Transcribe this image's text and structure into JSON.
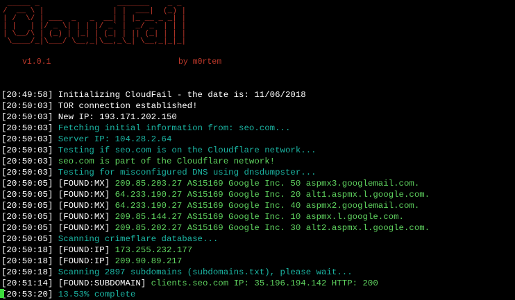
{
  "banner": {
    "ascii_art": " _____ _                 _______    _ _ \n/  __ \\ |               | |  ___|  (_) |\n| /  \\/ | ___  _   _  __| | |_ __ _ _| |\n| |   | |/ _ \\| | | |/ _` |  _/ _` | | |\n| \\__/\\ | (_) | |_| | (_| | || (_| | | |\n \\____/_|\\___/ \\__,_|\\__,_\\_| \\__,_|_|_|",
    "version": "v1.0.1",
    "author": "by m0rtem"
  },
  "colors": {
    "background": "#000000",
    "banner": "#c0392b",
    "white": "#ffffff",
    "cyan": "#1bb5a3",
    "green": "#5fd35f",
    "cursor": "#3ddc3d"
  },
  "log": [
    {
      "ts": "[20:49:58]",
      "text": "Initializing CloudFail - the date is: 11/06/2018",
      "style": "white"
    },
    {
      "ts": "[20:50:03]",
      "text": "TOR connection established!",
      "style": "white"
    },
    {
      "ts": "[20:50:03]",
      "text": "New IP: 193.171.202.150",
      "style": "white"
    },
    {
      "ts": "[20:50:03]",
      "text": "Fetching initial information from: seo.com...",
      "style": "cyan"
    },
    {
      "ts": "[20:50:03]",
      "text": "Server IP: 104.28.2.64",
      "style": "cyan"
    },
    {
      "ts": "[20:50:03]",
      "text": "Testing if seo.com is on the Cloudflare network...",
      "style": "cyan"
    },
    {
      "ts": "[20:50:03]",
      "text": "seo.com is part of the Cloudflare network!",
      "style": "green"
    },
    {
      "ts": "[20:50:03]",
      "text": "Testing for misconfigured DNS using dnsdumpster...",
      "style": "cyan"
    },
    {
      "ts": "[20:50:05]",
      "tag": "[FOUND:MX]",
      "text": "209.85.203.27 AS15169 Google Inc. 50 aspmx3.googlemail.com.",
      "style": "green"
    },
    {
      "ts": "[20:50:05]",
      "tag": "[FOUND:MX]",
      "text": "64.233.190.27 AS15169 Google Inc. 20 alt1.aspmx.l.google.com.",
      "style": "green"
    },
    {
      "ts": "[20:50:05]",
      "tag": "[FOUND:MX]",
      "text": "64.233.190.27 AS15169 Google Inc. 40 aspmx2.googlemail.com.",
      "style": "green"
    },
    {
      "ts": "[20:50:05]",
      "tag": "[FOUND:MX]",
      "text": "209.85.144.27 AS15169 Google Inc. 10 aspmx.l.google.com.",
      "style": "green"
    },
    {
      "ts": "[20:50:05]",
      "tag": "[FOUND:MX]",
      "text": "209.85.202.27 AS15169 Google Inc. 30 alt2.aspmx.l.google.com.",
      "style": "green"
    },
    {
      "ts": "[20:50:05]",
      "text": "Scanning crimeflare database...",
      "style": "cyan"
    },
    {
      "ts": "[20:50:18]",
      "tag": "[FOUND:IP]",
      "text": "173.255.232.177",
      "style": "green"
    },
    {
      "ts": "[20:50:18]",
      "tag": "[FOUND:IP]",
      "text": "209.90.89.217",
      "style": "green"
    },
    {
      "ts": "[20:50:18]",
      "text": "Scanning 2897 subdomains (subdomains.txt), please wait...",
      "style": "cyan"
    },
    {
      "ts": "[20:51:14]",
      "tag": "[FOUND:SUBDOMAIN]",
      "text": "clients.seo.com IP: 35.196.194.142 HTTP: 200",
      "style": "green"
    },
    {
      "ts": "[20:53:20]",
      "text": "13.53% complete",
      "style": "cyan",
      "cursor": true
    }
  ]
}
